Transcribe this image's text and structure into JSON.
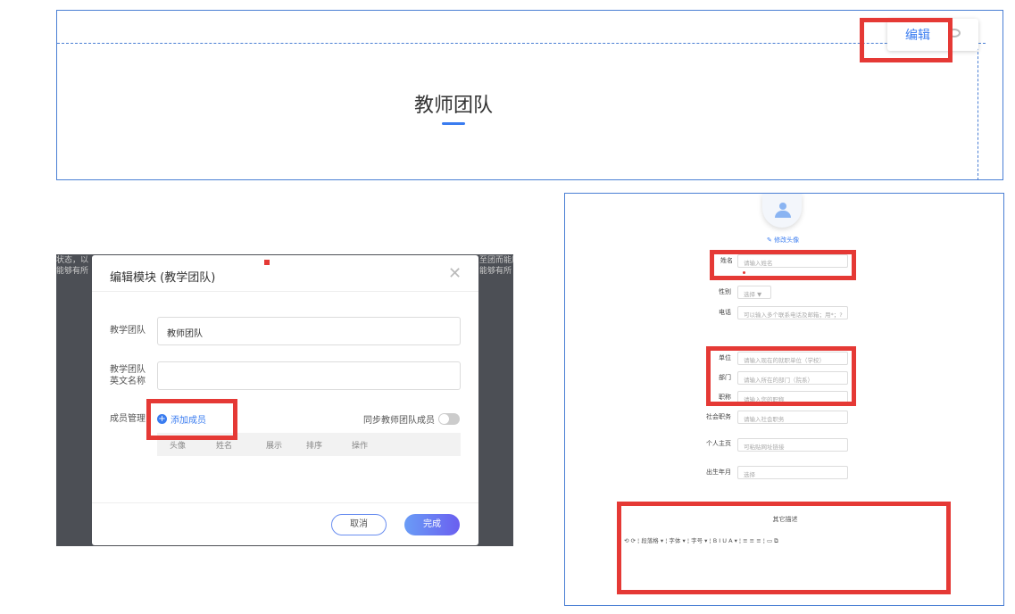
{
  "panel1": {
    "title": "教师团队",
    "edit_label": "编辑"
  },
  "panel2": {
    "background_text_left": "状态，以\n能够有所",
    "background_text_right": "至团而能展\n能够有所",
    "modal": {
      "title": "编辑模块 (教学团队)",
      "close_icon": "close-icon",
      "field1": {
        "label": "教学团队",
        "value": "教师团队"
      },
      "field2": {
        "label": "教学团队\n英文名称",
        "value": ""
      },
      "members_label": "成员管理",
      "add_member": "添加成员",
      "sync_label": "同步教师团队成员",
      "table_headers": [
        "头像",
        "姓名",
        "展示",
        "排序",
        "操作"
      ],
      "cancel": "取消",
      "done": "完成"
    }
  },
  "panel3": {
    "change_avatar": "✎ 修改头像",
    "fields": [
      {
        "label": "姓名",
        "placeholder": "请输入姓名"
      },
      {
        "label": "性别",
        "placeholder": "选择  ▼"
      },
      {
        "label": "电话",
        "placeholder": "可以输入多个联系电话及邮箱；用*；?"
      },
      {
        "label": "单位",
        "placeholder": "请输入现在的就职单位（学校）"
      },
      {
        "label": "部门",
        "placeholder": "请输入所在的部门（院系）"
      },
      {
        "label": "职称",
        "placeholder": "请输入您的职称"
      },
      {
        "label": "社会职务",
        "placeholder": "请输入社会职务"
      },
      {
        "label": "个人主页",
        "placeholder": "可粘贴网址链接"
      },
      {
        "label": "出生年月",
        "placeholder": "选择"
      }
    ],
    "other_desc": "其它描述",
    "toolbar": "⟲ ⟳ ¦ 段落格 ▾ ¦ 字体 ▾ ¦ 字号 ▾ ¦ B  I  U  A ▾ ¦ ≡ ≡ ≡ ¦ ▭ ⧉"
  },
  "colors": {
    "accent": "#3a7cf0",
    "highlight": "#e53935",
    "border": "#4a7fd4"
  }
}
